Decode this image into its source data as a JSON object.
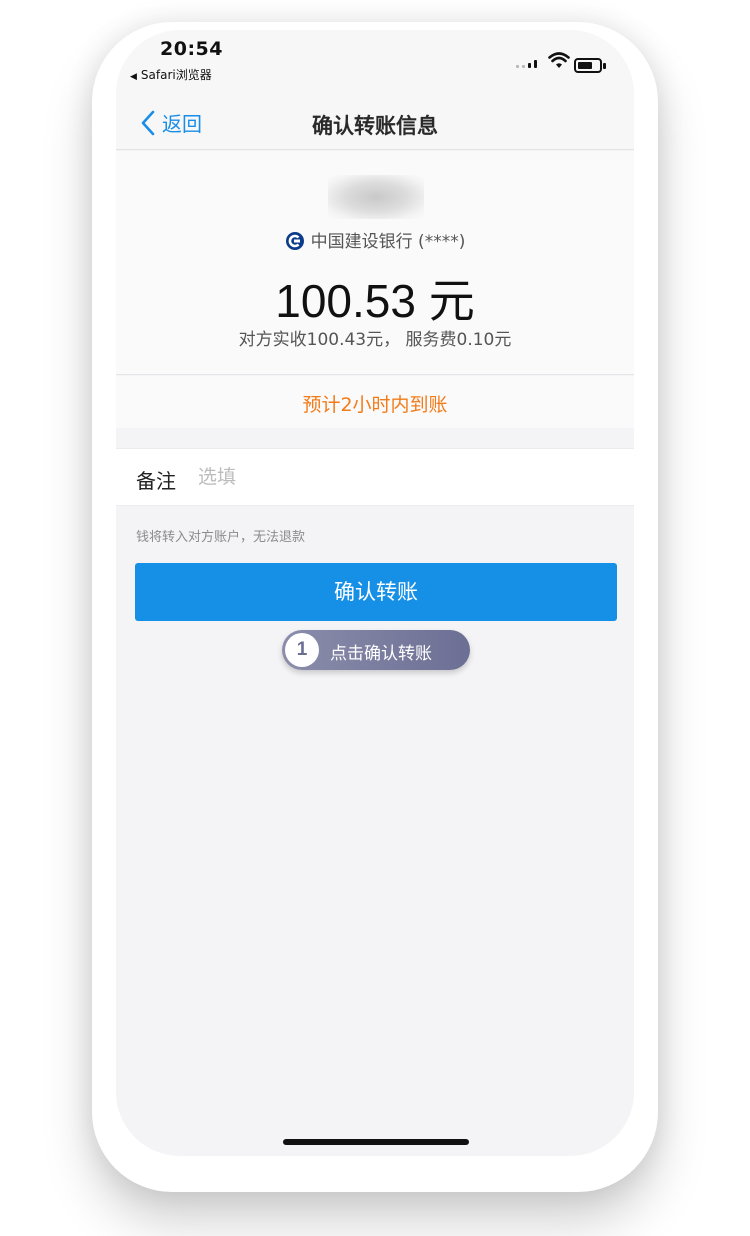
{
  "status_bar": {
    "time": "20:54",
    "back_app": "Safari浏览器"
  },
  "nav": {
    "back_label": "返回",
    "title": "确认转账信息"
  },
  "transfer": {
    "bank": "中国建设银行 (****)",
    "amount": "100.53 元",
    "fee_line": "对方实收100.43元， 服务费0.10元",
    "eta": "预计2小时内到账"
  },
  "note": {
    "label": "备注",
    "placeholder": "选填",
    "value": ""
  },
  "warning": "钱将转入对方账户，无法退款",
  "confirm_button": "确认转账",
  "hint": {
    "step": "1",
    "text": "点击确认转账"
  },
  "colors": {
    "accent": "#168fe7",
    "eta": "#f27c1a",
    "hint_bg": "#6c6f94"
  }
}
